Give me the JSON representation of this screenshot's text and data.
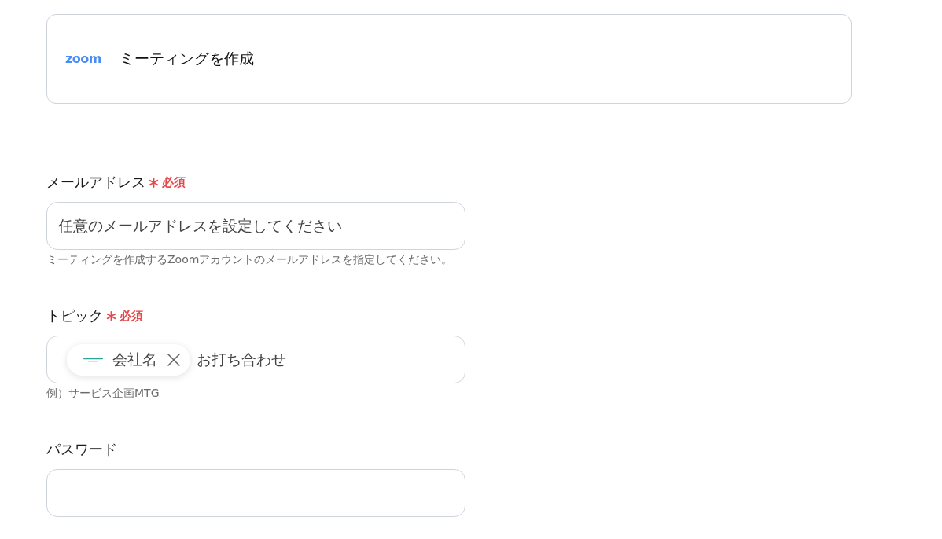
{
  "action_card": {
    "logo_text": "zoom",
    "title": "ミーティングを作成"
  },
  "fields": [
    {
      "kind": "text",
      "label": "メールアドレス",
      "required": true,
      "required_text": "必須",
      "value": "任意のメールアドレスを設定してください",
      "help": "ミーティングを作成するZoomアカウントのメールアドレスを指定してください。"
    },
    {
      "kind": "tokens",
      "label": "トピック",
      "required": true,
      "required_text": "必須",
      "tokens": [
        {
          "kind": "chip",
          "text": "会社名"
        },
        {
          "kind": "text",
          "text": "お打ち合わせ"
        }
      ],
      "help": "例）サービス企画MTG"
    },
    {
      "kind": "text",
      "label": "パスワード",
      "required": false
    }
  ]
}
